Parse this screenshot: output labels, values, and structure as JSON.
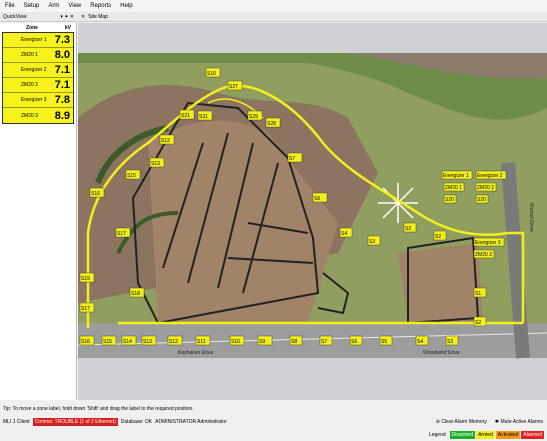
{
  "menu": [
    "File",
    "Setup",
    "Arm",
    "View",
    "Reports",
    "Help"
  ],
  "quickview": {
    "title": "QuickView",
    "pin": "▾ ✦ ✕",
    "col_zone": "Zone",
    "col_kv": "kV",
    "rows": [
      {
        "zone": "Energizer 1",
        "kv": "7.3"
      },
      {
        "zone": "ZM20 1",
        "kv": "8.0"
      },
      {
        "zone": "Energizer 2",
        "kv": "7.1"
      },
      {
        "zone": "ZM20 2",
        "kv": "7.1"
      },
      {
        "zone": "Energizer 3",
        "kv": "7.8"
      },
      {
        "zone": "ZM20 3",
        "kv": "8.9"
      }
    ]
  },
  "sitemap": {
    "title": "Site Map",
    "zones": [
      "S1",
      "S2",
      "S3",
      "S4",
      "S5",
      "S6",
      "S7",
      "S8",
      "S9",
      "S10",
      "S11",
      "S12",
      "S13",
      "S14",
      "S15",
      "S16",
      "S17",
      "S18",
      "S19",
      "S20",
      "S21",
      "S22",
      "S23",
      "S24",
      "S25",
      "S26",
      "S27",
      "S28",
      "S29",
      "S30",
      "S31",
      "S32",
      "S33",
      "S34"
    ],
    "devices": [
      {
        "name": "Energizer 1",
        "sub": "ZM20 1",
        "zone": "S20"
      },
      {
        "name": "Energizer 2",
        "sub": "ZM20 2",
        "zone": "S20"
      },
      {
        "name": "Energizer 3",
        "sub": "ZM20 3",
        "zone": ""
      }
    ],
    "roads": [
      "Keyhaven Drive",
      "Woodwind Drive",
      "Wurzel Drive"
    ]
  },
  "tip": "Tip: To move a zone label, hold down 'Shift' and drag the label to the required position.",
  "status": {
    "client": "MLI 1 Client",
    "comms": "Comms: TROUBLE (1 of 2 Ethernet)",
    "database": "Database: OK",
    "user": "ADMINISTRATOR Administrator",
    "clear_alarm": "Clear Alarm Memory",
    "mute": "Mute Active Alarms"
  },
  "legend": {
    "label": "Legend",
    "items": [
      {
        "text": "Disarmed",
        "color": "#1fae2a"
      },
      {
        "text": "Armed",
        "color": "#f2ef1c"
      },
      {
        "text": "Activated",
        "color": "#f29a1c"
      },
      {
        "text": "Alarmed",
        "color": "#e02424"
      }
    ]
  }
}
